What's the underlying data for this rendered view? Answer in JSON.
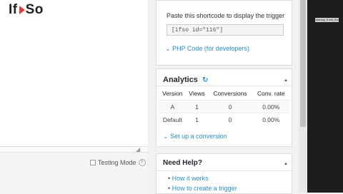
{
  "logo": {
    "text_left": "If",
    "text_right": "So"
  },
  "editor": {
    "testing_mode_label": "Testing Mode",
    "help_icon": "?"
  },
  "shortcode_box": {
    "label": "Paste this shortcode to display the trigger",
    "shortcode": "[ifso id=\"116\"]",
    "php_link": "PHP Code (for developers)"
  },
  "analytics": {
    "title": "Analytics",
    "refresh_icon": "↻",
    "collapse_icon": "▲",
    "columns": [
      "Version",
      "Views",
      "Conversions",
      "Conv. rate"
    ],
    "rows": [
      [
        "A",
        "1",
        "0",
        "0.00%"
      ],
      [
        "Default",
        "1",
        "0",
        "0.00%"
      ]
    ],
    "setup_link": "Set up a conversion"
  },
  "help_box": {
    "title": "Need Help?",
    "collapse_icon": "▲",
    "links": [
      "How it works",
      "How to create a trigger"
    ]
  },
  "tooltip": {
    "text": "Already_Exist_Etc"
  },
  "colors": {
    "link": "#2a8ec7",
    "logo_arrow": "#e43b3b"
  }
}
